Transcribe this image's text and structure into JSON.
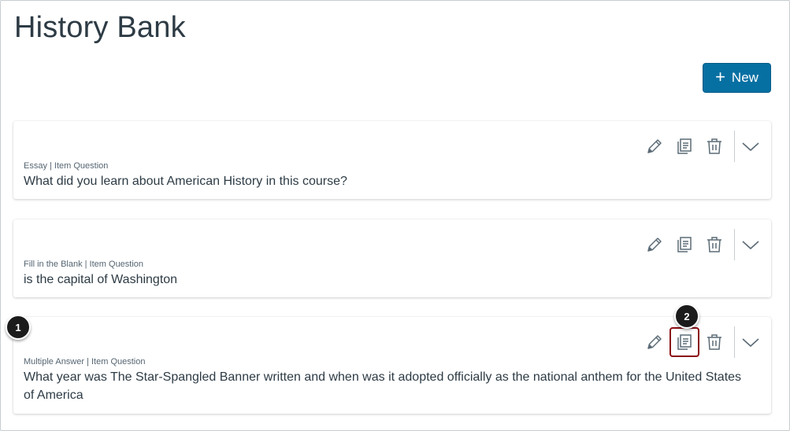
{
  "page": {
    "title": "History Bank"
  },
  "toolbar": {
    "new_plus": "+",
    "new_label": "New"
  },
  "questions": [
    {
      "type": "Essay | Item Question",
      "text": "What did you learn about American History in this course?"
    },
    {
      "type": "Fill in the Blank | Item Question",
      "text": "is the capital of Washington"
    },
    {
      "type": "Multiple Answer | Item Question",
      "text": "What year was The Star-Spangled Banner written and when was it adopted officially as the national anthem for the United States of America"
    }
  ],
  "callouts": {
    "one": "1",
    "two": "2"
  },
  "icons": {
    "edit": "pencil-icon",
    "duplicate": "copy-icon",
    "delete": "trash-icon",
    "expand": "chevron-down-icon"
  },
  "colors": {
    "accent": "#0770a3",
    "highlight": "#8b0d12",
    "text": "#2d3b45"
  }
}
